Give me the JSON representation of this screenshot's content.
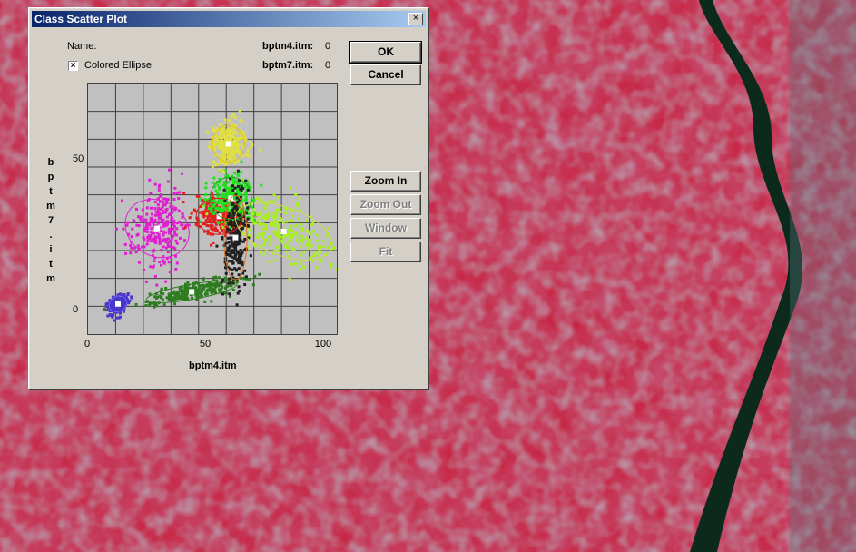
{
  "window": {
    "title": "Class Scatter Plot",
    "close": "×"
  },
  "info": {
    "name_label": "Name:",
    "colored_ellipse_label": "Colored Ellipse",
    "colored_ellipse_checked": true,
    "check_mark": "×",
    "band_x_readout_label": "bptm4.itm:",
    "band_x_readout_value": "0",
    "band_y_readout_label": "bptm7.itm:",
    "band_y_readout_value": "0"
  },
  "buttons": {
    "ok": "OK",
    "cancel": "Cancel",
    "zoom_in": "Zoom In",
    "zoom_out": "Zoom Out",
    "window": "Window",
    "fit": "Fit"
  },
  "chart_data": {
    "type": "scatter",
    "xlabel": "bptm4.itm",
    "ylabel": "bptm7.itm",
    "xlim": [
      0,
      108
    ],
    "ylim": [
      -8,
      75
    ],
    "x_ticks": [
      0,
      50,
      100
    ],
    "y_ticks": [
      0,
      50
    ],
    "grid": true,
    "classes": [
      {
        "color": "#4a36c8",
        "cx": 13,
        "cy": 2,
        "rx": 4,
        "ry": 2.5,
        "angle": 30,
        "ellipse_color": "#6666ff"
      },
      {
        "color": "#2e7d20",
        "cx": 45,
        "cy": 6,
        "rx": 20,
        "ry": 2.5,
        "angle": 10,
        "ellipse_color": "#2e7d20"
      },
      {
        "color": "#e020d0",
        "cx": 30,
        "cy": 27,
        "rx": 12,
        "ry": 11,
        "angle": 60,
        "ellipse_color": "#e020d0"
      },
      {
        "color": "#e02020",
        "cx": 57,
        "cy": 31,
        "rx": 10,
        "ry": 6,
        "angle": 0,
        "ellipse_color": "#e02020"
      },
      {
        "color": "#20e020",
        "cx": 62,
        "cy": 37,
        "rx": 9,
        "ry": 7,
        "angle": 0,
        "ellipse_color": "#20a020"
      },
      {
        "color": "#a8f020",
        "cx": 85,
        "cy": 26,
        "rx": 22,
        "ry": 8,
        "angle": -20,
        "ellipse_color": "#c8e040"
      },
      {
        "color": "#e0e040",
        "cx": 61,
        "cy": 55,
        "rx": 7,
        "ry": 6,
        "angle": 0,
        "ellipse_color": "#e0c020"
      },
      {
        "color": "#202020",
        "cx": 64,
        "cy": 24,
        "rx": 5,
        "ry": 14,
        "angle": 0,
        "ellipse_color": "#e07020"
      }
    ]
  }
}
